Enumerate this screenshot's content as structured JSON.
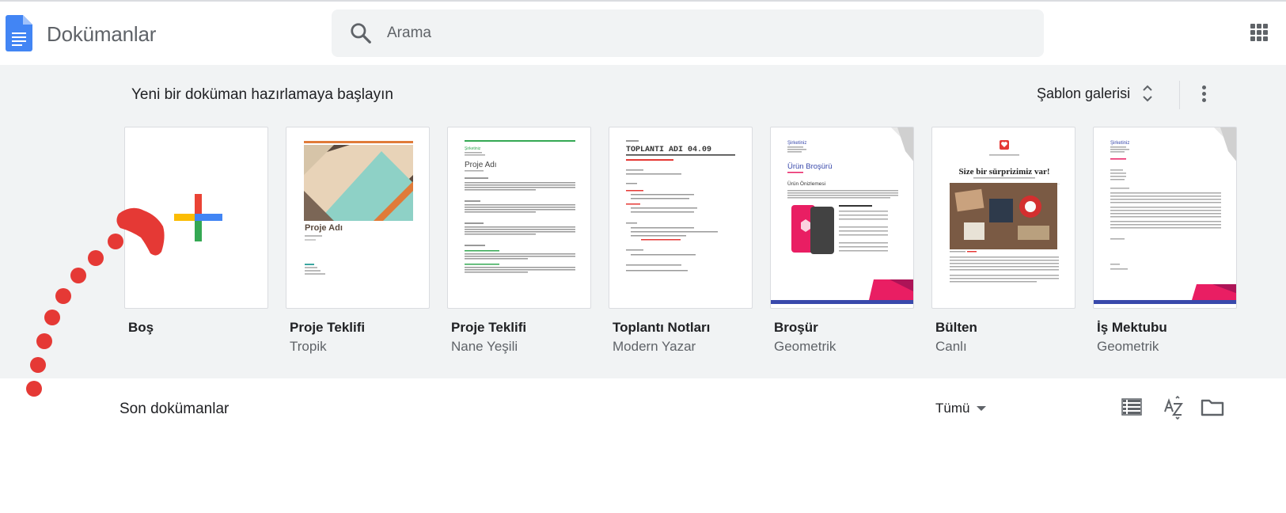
{
  "header": {
    "app_title": "Dokümanlar",
    "search_placeholder": "Arama",
    "logo_color": "#4285f4",
    "icons": [
      "docs-logo-icon",
      "search-icon",
      "apps-grid-icon"
    ]
  },
  "templates": {
    "title": "Yeni bir doküman hazırlamaya başlayın",
    "gallery_label": "Şablon galerisi",
    "items": [
      {
        "name": "Boş",
        "subtitle": ""
      },
      {
        "name": "Proje Teklifi",
        "subtitle": "Tropik",
        "thumb_title": "Proje Adı"
      },
      {
        "name": "Proje Teklifi",
        "subtitle": "Nane Yeşili",
        "thumb_title": "Proje Adı",
        "thumb_company": "Şirketiniz"
      },
      {
        "name": "Toplantı Notları",
        "subtitle": "Modern Yazar",
        "thumb_title": "TOPLANTI ADI 04.09"
      },
      {
        "name": "Broşür",
        "subtitle": "Geometrik",
        "thumb_title": "Ürün Broşürü",
        "thumb_company": "Şirketiniz",
        "thumb_section": "Ürün Önizlemesi"
      },
      {
        "name": "Bülten",
        "subtitle": "Canlı",
        "thumb_title": "Size bir sürprizimiz var!"
      },
      {
        "name": "İş Mektubu",
        "subtitle": "Geometrik",
        "thumb_company": "Şirketiniz"
      }
    ]
  },
  "recent": {
    "title": "Son dokümanlar",
    "owner_filter": "Tümü",
    "icons": [
      "list-view-icon",
      "sort-az-icon",
      "folder-icon"
    ]
  },
  "colors": {
    "accent_blue": "#4285f4",
    "plus_red": "#ea4335",
    "plus_yellow": "#fbbc04",
    "plus_green": "#34a853",
    "annotation_red": "#e53935",
    "background_gray": "#f1f3f4"
  }
}
